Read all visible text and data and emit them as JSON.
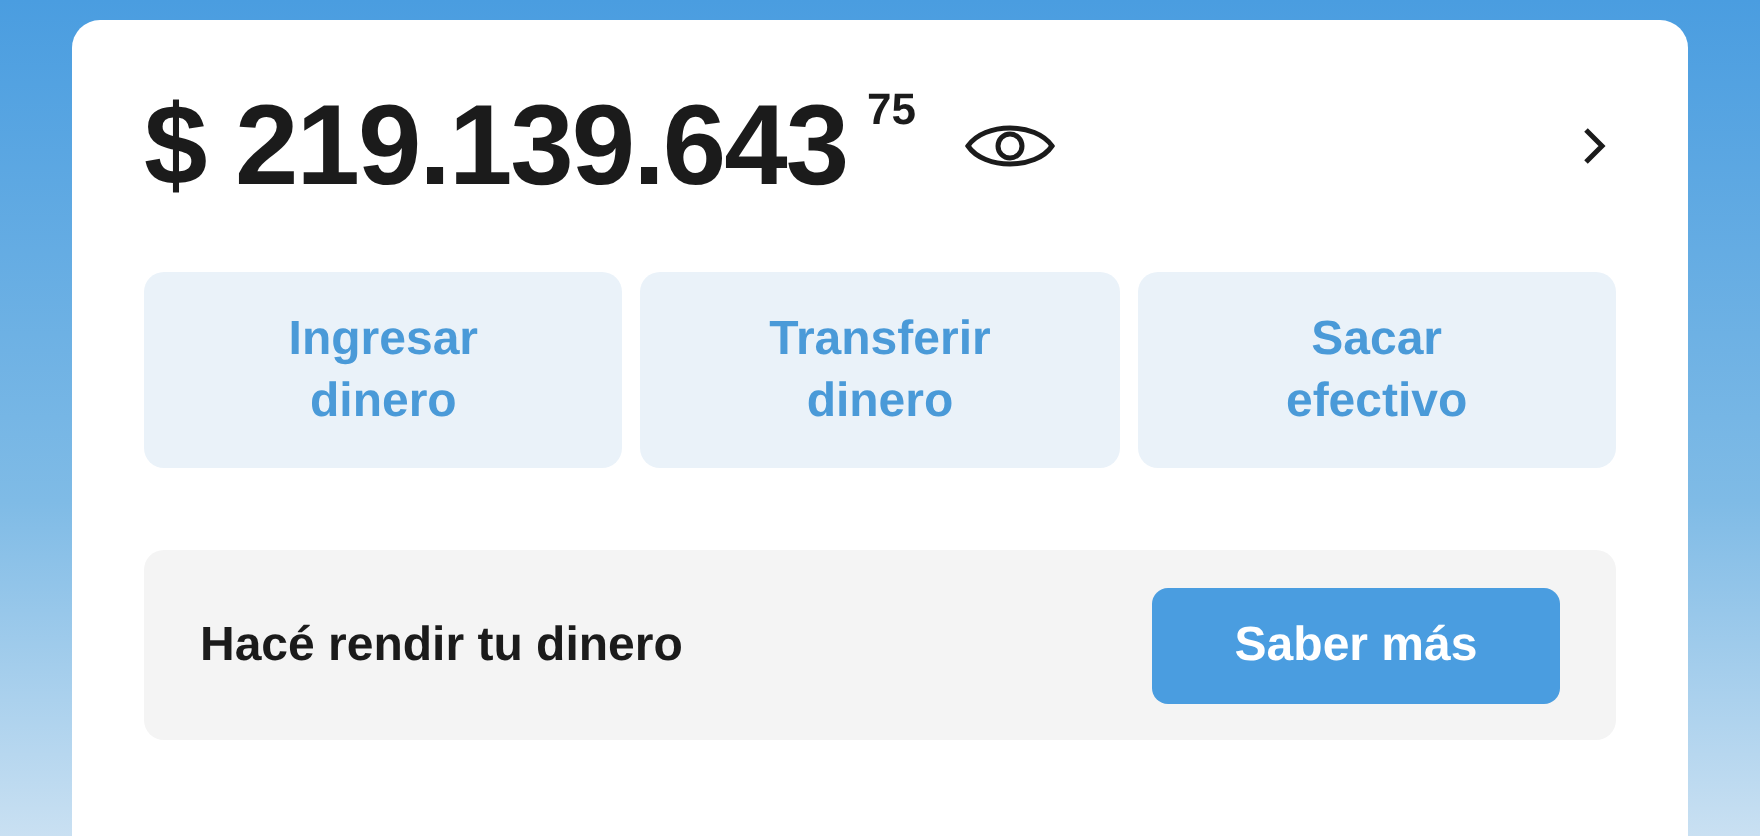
{
  "balance": {
    "amount": "$ 219.139.643",
    "cents": "75"
  },
  "actions": [
    {
      "label": "Ingresar dinero"
    },
    {
      "label": "Transferir dinero"
    },
    {
      "label": "Sacar efectivo"
    }
  ],
  "promo": {
    "text": "Hacé rendir tu dinero",
    "button": "Saber más"
  }
}
